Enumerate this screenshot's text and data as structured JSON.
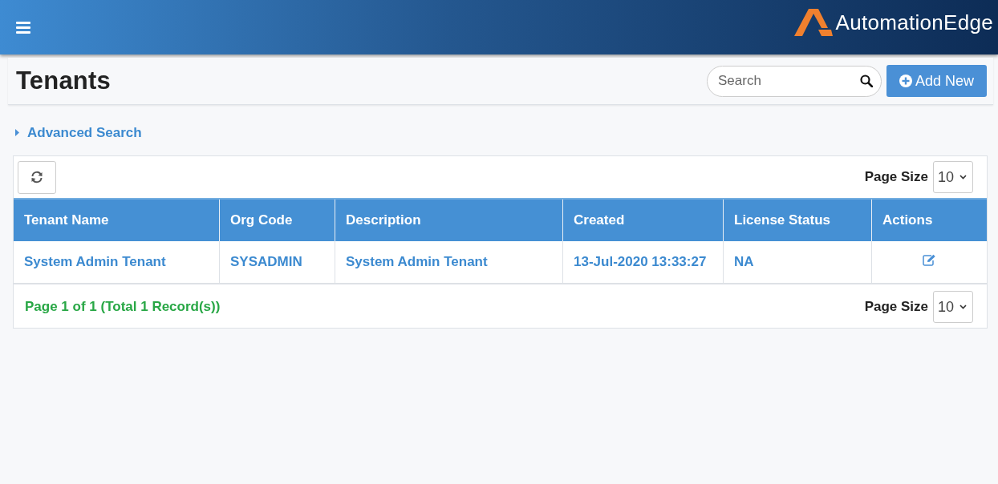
{
  "header": {
    "brand": "AutomationEdge"
  },
  "page": {
    "title": "Tenants",
    "search": {
      "placeholder": "Search"
    },
    "add_button": "Add New"
  },
  "advanced_search": {
    "label": "Advanced Search",
    "expanded": false
  },
  "table": {
    "page_size_label": "Page Size",
    "page_size": "10",
    "columns": [
      "Tenant Name",
      "Org Code",
      "Description",
      "Created",
      "License Status",
      "Actions"
    ],
    "rows": [
      {
        "cells": [
          "System Admin Tenant",
          "SYSADMIN",
          "System Admin Tenant",
          "13-Jul-2020 13:33:27",
          "NA"
        ]
      }
    ],
    "footer": {
      "summary": "Page 1 of 1 (Total 1 Record(s))",
      "page_size_label": "Page Size",
      "page_size": "10"
    }
  }
}
